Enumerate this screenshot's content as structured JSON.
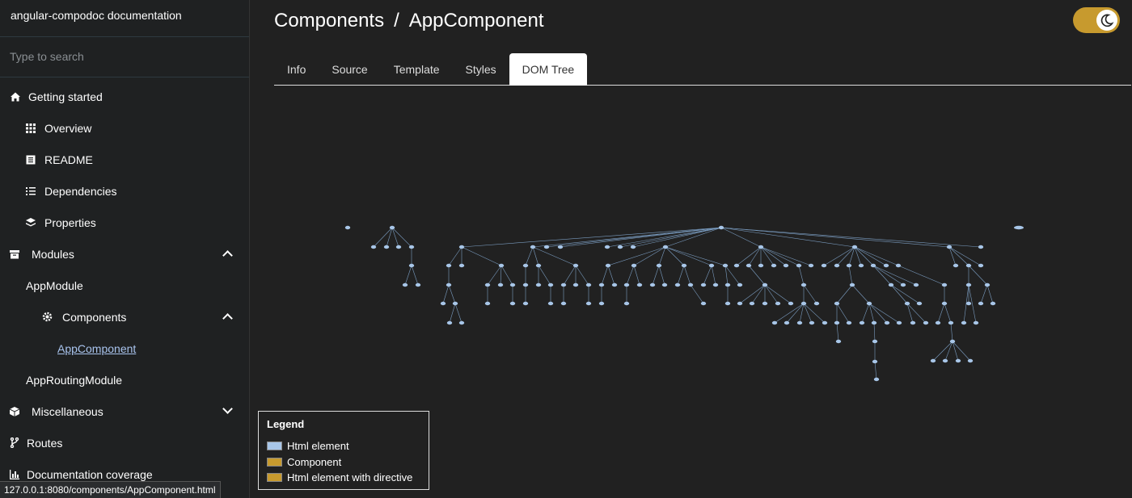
{
  "sidebar": {
    "title": "angular-compodoc documentation",
    "search_placeholder": "Type to search",
    "items": [
      {
        "label": "Getting started",
        "icon": "home-icon"
      },
      {
        "label": "Overview",
        "icon": "grid-icon"
      },
      {
        "label": "README",
        "icon": "book-icon"
      },
      {
        "label": "Dependencies",
        "icon": "list-icon"
      },
      {
        "label": "Properties",
        "icon": "layers-icon"
      },
      {
        "label": "Modules",
        "icon": "archive-icon"
      },
      {
        "label": "AppModule"
      },
      {
        "label": "Components",
        "icon": "cog-icon"
      },
      {
        "label": "AppComponent"
      },
      {
        "label": "AppRoutingModule"
      },
      {
        "label": "Miscellaneous",
        "icon": "cube-icon"
      },
      {
        "label": "Routes",
        "icon": "fork-icon"
      },
      {
        "label": "Documentation coverage",
        "icon": "bar-chart-icon"
      }
    ]
  },
  "status_url": "127.0.0.1:8080/components/AppComponent.html",
  "breadcrumb": {
    "section": "Components",
    "separator": "/",
    "page": "AppComponent"
  },
  "tabs": [
    "Info",
    "Source",
    "Template",
    "Styles",
    "DOM Tree"
  ],
  "active_tab": "DOM Tree",
  "legend": {
    "title": "Legend",
    "items": [
      {
        "label": "Html element",
        "color": "#a8c6e8"
      },
      {
        "label": "Component",
        "color": "#c79a2e"
      },
      {
        "label": "Html element with directive",
        "color": "#c79a2e"
      }
    ]
  },
  "colors": {
    "accent": "#c79a2e",
    "node": "#a8c6e8",
    "edge": "#7a9cc0"
  }
}
